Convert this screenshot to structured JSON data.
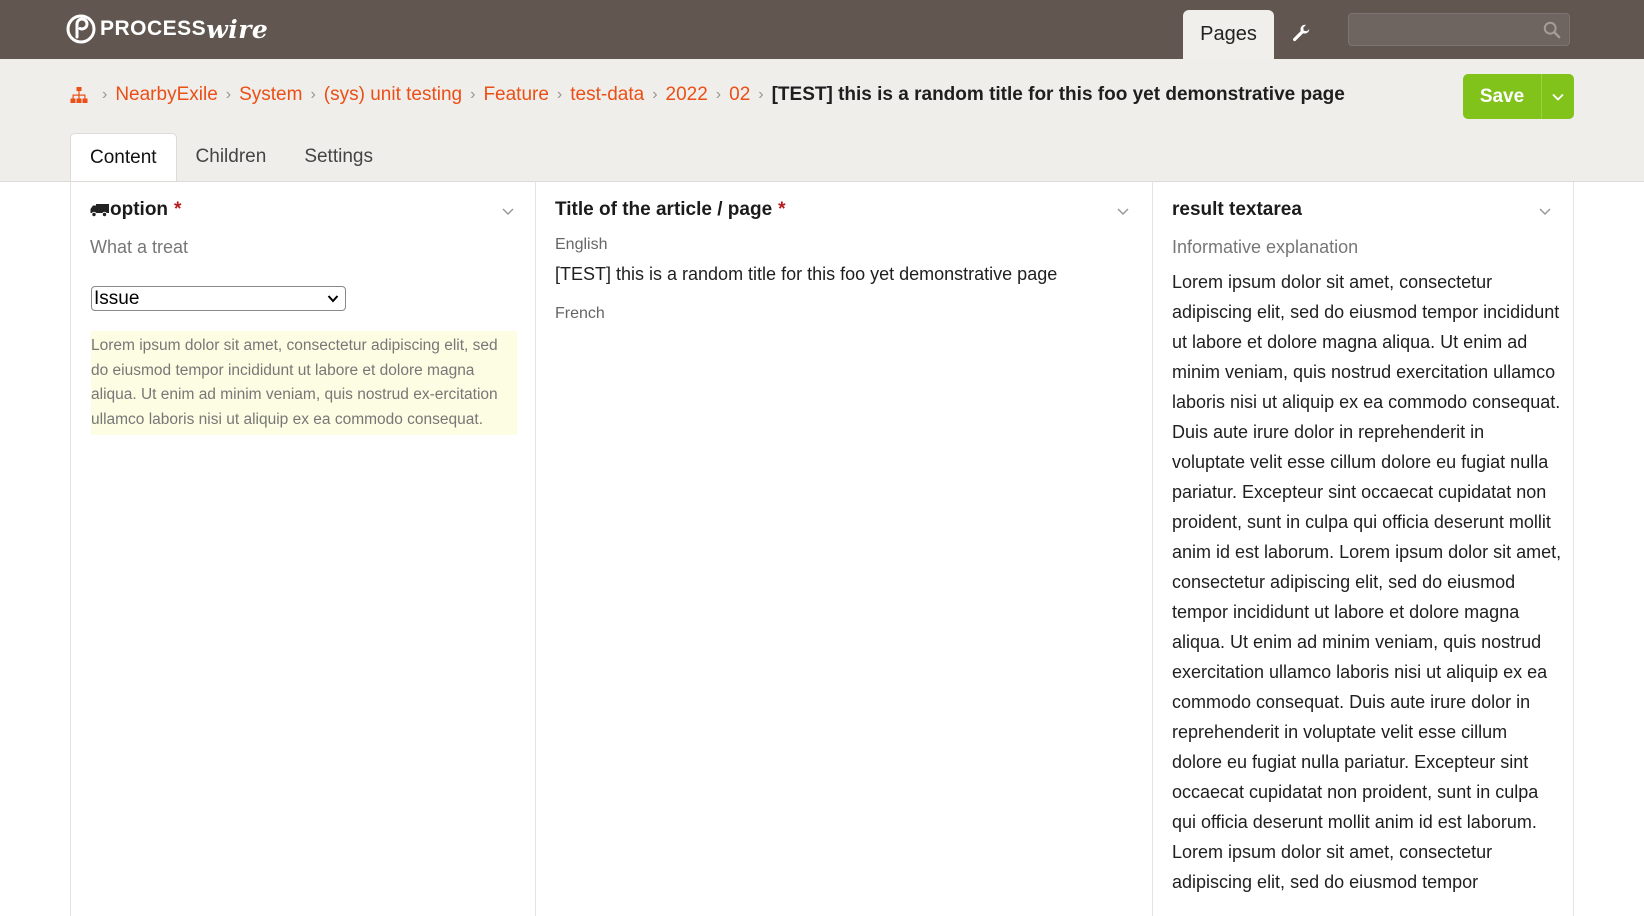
{
  "header": {
    "logo_word_1": "PROCESS",
    "logo_word_2": "wire",
    "nav_pages": "Pages",
    "search_value": ""
  },
  "breadcrumb": {
    "items": [
      "NearbyExile",
      "System",
      "(sys) unit testing",
      "Feature",
      "test-data",
      "2022",
      "02"
    ],
    "current": "[TEST] this is a random title for this foo yet demonstrative page"
  },
  "actions": {
    "save_label": "Save"
  },
  "tabs": [
    "Content",
    "Children",
    "Settings"
  ],
  "fields": {
    "option": {
      "label": "option",
      "required_mark": "*",
      "description": "What a treat",
      "selected": "Issue",
      "notes": "Lorem ipsum dolor sit amet, consectetur adipiscing elit, sed do eiusmod tempor incididunt ut labore et dolore magna aliqua. Ut enim ad minim veniam, quis nostrud ex-ercitation ullamco laboris nisi ut aliquip ex ea commodo consequat."
    },
    "title": {
      "label": "Title of the article / page",
      "required_mark": "*",
      "lang_en": "English",
      "value_en": "[TEST] this is a random title for this foo yet demonstrative page",
      "lang_fr": "French",
      "value_fr": ""
    },
    "result": {
      "label": "result textarea",
      "description": "Informative explanation",
      "value": "Lorem ipsum dolor sit amet, consectetur adipiscing elit, sed do eiusmod tempor incididunt ut labore et dolore magna aliqua. Ut enim ad minim veniam, quis nostrud exercitation ullamco laboris nisi ut aliquip ex ea commodo consequat. Duis aute irure dolor in reprehenderit in voluptate velit esse cillum dolore eu fugiat nulla pariatur. Excepteur sint occaecat cupidatat non proident, sunt in culpa qui officia deserunt mollit anim id est laborum. Lorem ipsum dolor sit amet, consectetur adipiscing elit, sed do eiusmod tempor incididunt ut labore et dolore magna aliqua. Ut enim ad minim veniam, quis nostrud exercitation ullamco laboris nisi ut aliquip ex ea commodo consequat. Duis aute irure dolor in reprehenderit in voluptate velit esse cillum dolore eu fugiat nulla pariatur. Excepteur sint occaecat cupidatat non proident, sunt in culpa qui officia deserunt mollit anim id est laborum. Lorem ipsum dolor sit amet, consectetur adipiscing elit, sed do eiusmod tempor"
    }
  },
  "colors": {
    "masthead": "#625650",
    "link": "#eb4f16",
    "save": "#81c21b",
    "notes_bg": "#fdfde3"
  },
  "icons": [
    "processwire-logo-icon",
    "wrench-icon",
    "search-icon",
    "sitemap-icon",
    "chevron-right-icon",
    "chevron-down-icon",
    "truck-icon"
  ]
}
